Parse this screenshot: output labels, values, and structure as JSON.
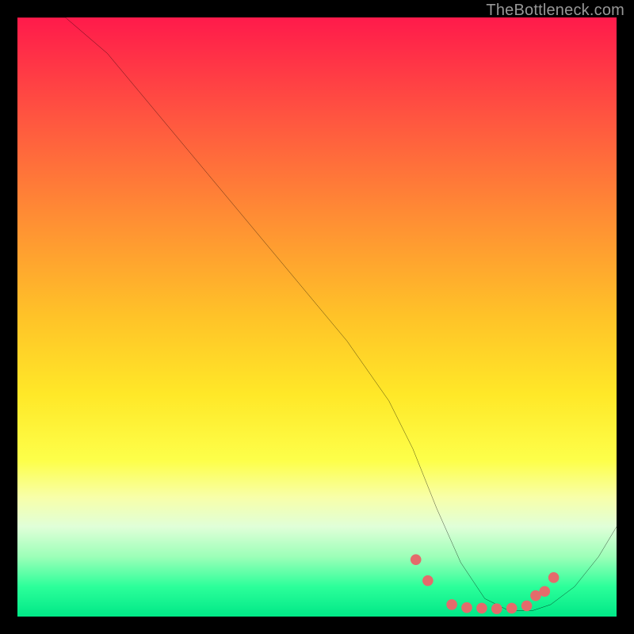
{
  "attribution": "TheBottleneck.com",
  "chart_data": {
    "type": "line",
    "title": "",
    "xlabel": "",
    "ylabel": "",
    "xlim": [
      0,
      100
    ],
    "ylim": [
      0,
      100
    ],
    "series": [
      {
        "name": "curve",
        "x": [
          0,
          8,
          15,
          25,
          35,
          45,
          55,
          62,
          66,
          70,
          74,
          78,
          82,
          86,
          89,
          93,
          97,
          100
        ],
        "y": [
          100,
          100,
          94,
          82,
          70,
          58,
          46,
          36,
          28,
          18,
          9,
          3,
          1,
          1,
          2,
          5,
          10,
          15
        ]
      }
    ],
    "markers": {
      "name": "dots",
      "color": "#e46b6b",
      "x": [
        66.5,
        68.5,
        72.5,
        75,
        77.5,
        80,
        82.5,
        85,
        86.5,
        88,
        89.5
      ],
      "y": [
        9.5,
        6.0,
        2.0,
        1.5,
        1.4,
        1.3,
        1.4,
        1.8,
        3.5,
        4.2,
        6.5
      ]
    }
  }
}
